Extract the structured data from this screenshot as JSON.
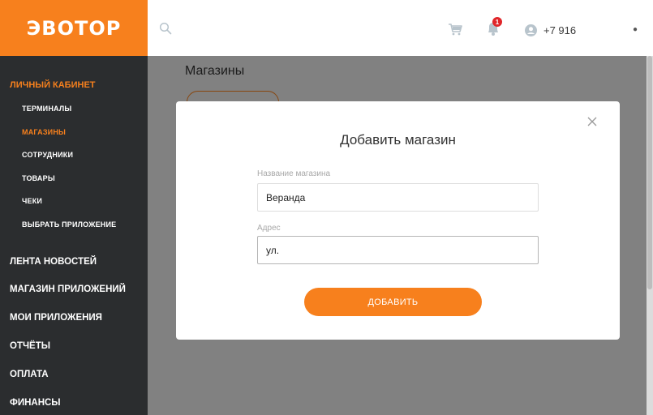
{
  "logo": {
    "text": "ЭВОТОР"
  },
  "topbar": {
    "phone": "+7 916",
    "notification_count": "1",
    "icons": [
      "search-icon",
      "cart-icon",
      "bell-icon",
      "user-icon",
      "chevron-down-icon"
    ]
  },
  "sidebar": {
    "section_title": "ЛИЧНЫЙ КАБИНЕТ",
    "sub_items": [
      {
        "label": "ТЕРМИНАЛЫ",
        "active": false
      },
      {
        "label": "МАГАЗИНЫ",
        "active": true
      },
      {
        "label": "СОТРУДНИКИ",
        "active": false
      },
      {
        "label": "ТОВАРЫ",
        "active": false
      },
      {
        "label": "ЧЕКИ",
        "active": false
      },
      {
        "label": "ВЫБРАТЬ ПРИЛОЖЕНИЕ",
        "active": false
      }
    ],
    "main_items": [
      {
        "label": "ЛЕНТА НОВОСТЕЙ"
      },
      {
        "label": "МАГАЗИН ПРИЛОЖЕНИЙ"
      },
      {
        "label": "МОИ ПРИЛОЖЕНИЯ"
      },
      {
        "label": "ОТЧЁТЫ"
      },
      {
        "label": "ОПЛАТА"
      },
      {
        "label": "ФИНАНСЫ"
      }
    ]
  },
  "main": {
    "title": "Магазины"
  },
  "modal": {
    "title": "Добавить магазин",
    "name_label": "Название магазина",
    "name_value": "Веранда",
    "address_label": "Адрес",
    "address_value": "ул.",
    "submit_label": "ДОБАВИТЬ"
  },
  "colors": {
    "accent": "#f7801d",
    "sidebar_bg": "#2b2d2f",
    "badge": "#e0262a"
  }
}
